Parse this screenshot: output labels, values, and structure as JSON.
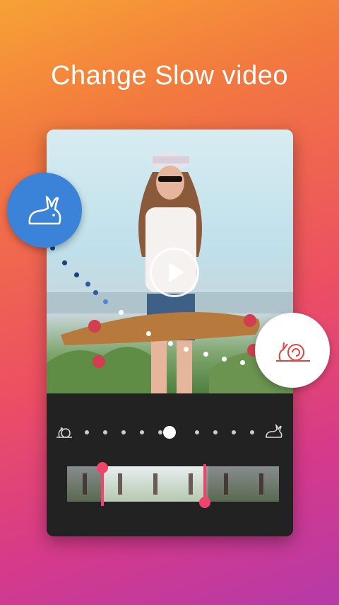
{
  "headline": "Change Slow video",
  "colors": {
    "accent_pink": "#f0446b",
    "fast_bubble": "#3b82d9",
    "slow_bubble": "#ffffff",
    "slow_icon": "#e0463d",
    "panel_bg": "#222222"
  },
  "icons": {
    "fast": "rabbit-icon",
    "slow": "snail-icon",
    "play": "play-icon"
  },
  "speed_slider": {
    "min_icon": "snail-icon",
    "max_icon": "rabbit-icon",
    "steps": 11,
    "selected_step": 5
  },
  "film_strip": {
    "frames": 6,
    "trim_start": 0.17,
    "trim_end": 0.65
  }
}
